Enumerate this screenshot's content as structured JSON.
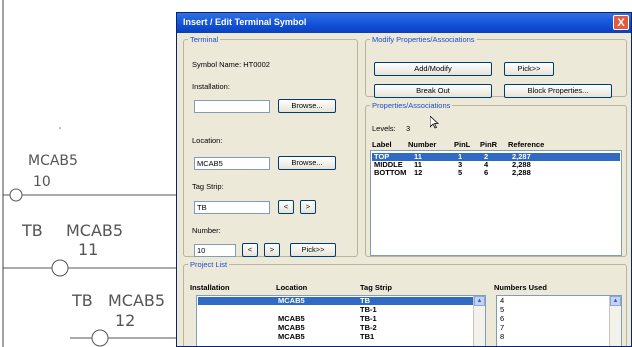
{
  "drawing": {
    "labels": [
      {
        "text": "MCAB5"
      },
      {
        "text": "10"
      },
      {
        "text": "TB"
      },
      {
        "text": "MCAB5"
      },
      {
        "text": "11"
      },
      {
        "text": "TB"
      },
      {
        "text": "MCAB5"
      },
      {
        "text": "12"
      }
    ]
  },
  "dialog": {
    "title": "Insert / Edit Terminal Symbol",
    "close_label": "X",
    "terminal": {
      "legend": "Terminal",
      "symbol_name": "Symbol Name: HT0002",
      "installation_label": "Installation:",
      "installation_value": "",
      "installation_browse": "Browse...",
      "location_label": "Location:",
      "location_value": "MCAB5",
      "location_browse": "Browse...",
      "tagstrip_label": "Tag Strip:",
      "tagstrip_value": "TB",
      "tagstrip_prev": "<",
      "tagstrip_next": ">",
      "number_label": "Number:",
      "number_value": "10",
      "number_prev": "<",
      "number_next": ">",
      "pick_label": "Pick>>"
    },
    "modify": {
      "legend": "Modify Properties/Associations",
      "add_modify": "Add/Modify",
      "pick": "Pick>>",
      "break_out": "Break Out",
      "block_properties": "Block Properties..."
    },
    "properties": {
      "legend": "Properties/Associations",
      "levels_label": "Levels:",
      "levels_value": "3",
      "headers": [
        "Label",
        "Number",
        "PinL",
        "PinR",
        "Reference"
      ],
      "rows": [
        {
          "label": "TOP",
          "number": "11",
          "pinl": "1",
          "pinr": "2",
          "reference": "2,287",
          "selected": true
        },
        {
          "label": "MIDDLE",
          "number": "11",
          "pinl": "3",
          "pinr": "4",
          "reference": "2,288",
          "selected": false
        },
        {
          "label": "BOTTOM",
          "number": "12",
          "pinl": "5",
          "pinr": "6",
          "reference": "2,288",
          "selected": false
        }
      ]
    },
    "project_list": {
      "legend": "Project List",
      "headers": [
        "Installation",
        "Location",
        "Tag Strip",
        "Numbers Used"
      ],
      "rows": [
        {
          "installation": "",
          "location": "MCAB5",
          "tagstrip": "TB",
          "selected": true
        },
        {
          "installation": "",
          "location": "",
          "tagstrip": "TB-1",
          "selected": false
        },
        {
          "installation": "",
          "location": "MCAB5",
          "tagstrip": "TB-1",
          "selected": false
        },
        {
          "installation": "",
          "location": "MCAB5",
          "tagstrip": "TB-2",
          "selected": false
        },
        {
          "installation": "",
          "location": "MCAB5",
          "tagstrip": "TB1",
          "selected": false
        }
      ],
      "numbers_used": [
        "4",
        "5",
        "6",
        "7",
        "8"
      ]
    }
  }
}
